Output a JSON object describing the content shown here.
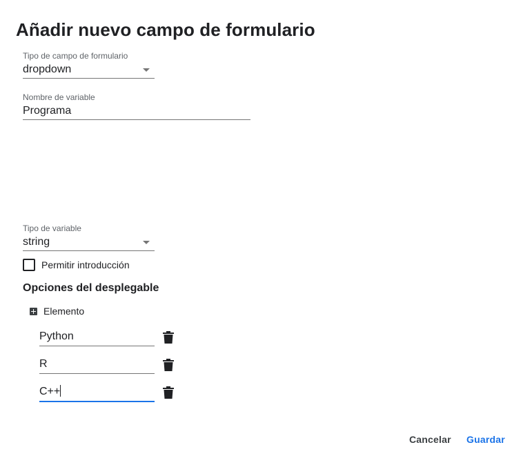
{
  "dialog": {
    "title": "Añadir nuevo campo de formulario"
  },
  "form_field_type": {
    "label": "Tipo de campo de formulario",
    "value": "dropdown"
  },
  "variable_name": {
    "label": "Nombre de variable",
    "value": "Programa"
  },
  "variable_type": {
    "label": "Tipo de variable",
    "value": "string"
  },
  "allow_input": {
    "label": "Permitir introducción",
    "checked": false
  },
  "dropdown_options": {
    "heading": "Opciones del desplegable",
    "add_label": "Elemento",
    "items": [
      {
        "value": "Python"
      },
      {
        "value": "R"
      },
      {
        "value": "C++"
      }
    ]
  },
  "footer": {
    "cancel_label": "Cancelar",
    "save_label": "Guardar"
  },
  "colors": {
    "accent": "#1a73e8",
    "text": "#202124",
    "underline": "#757575"
  }
}
